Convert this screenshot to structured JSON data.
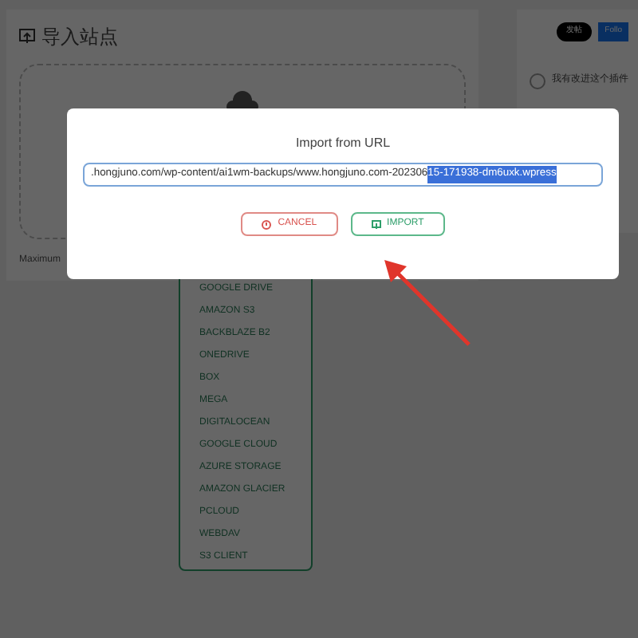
{
  "page": {
    "title": "导入站点",
    "max_note": "Maximum",
    "share_button": "发帖",
    "follow_button": "Follo",
    "feedback": "我有改进这个插件",
    "feedback_selected": false
  },
  "storage_menu": {
    "items": [
      "GOOGLE DRIVE",
      "AMAZON S3",
      "BACKBLAZE B2",
      "ONEDRIVE",
      "BOX",
      "MEGA",
      "DIGITALOCEAN",
      "GOOGLE CLOUD",
      "AZURE STORAGE",
      "AMAZON GLACIER",
      "PCLOUD",
      "WEBDAV",
      "S3 CLIENT"
    ]
  },
  "dialog": {
    "title": "Import from URL",
    "url": ".hongjuno.com/wp-content/ai1wm-backups/www.hongjuno.com-202306",
    "url_selected": "15-171938-dm6uxk.wpress",
    "buttons": [
      {
        "kind": "cancel",
        "label": "CANCEL"
      },
      {
        "kind": "import",
        "label": "IMPORT"
      }
    ]
  }
}
